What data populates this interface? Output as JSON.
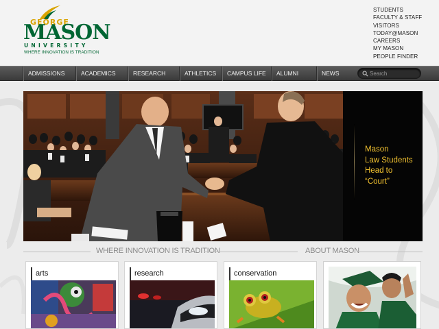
{
  "brand": {
    "george": "GEORGE",
    "mason": "MASON",
    "university": "UNIVERSITY",
    "tagline": "WHERE INNOVATION IS TRADITION",
    "colors": {
      "green": "#006633",
      "gold": "#d9a400"
    }
  },
  "quick_links": [
    "STUDENTS",
    "FACULTY & STAFF",
    "VISITORS",
    "TODAY@MASON",
    "CAREERS",
    "MY MASON",
    "PEOPLE FINDER"
  ],
  "nav": {
    "items": [
      "ADMISSIONS",
      "ACADEMICS",
      "RESEARCH",
      "ATHLETICS",
      "CAMPUS LIFE",
      "ALUMNI",
      "NEWS"
    ],
    "search_placeholder": "Search"
  },
  "hero": {
    "caption_lines": [
      "Mason",
      "Law Students",
      "Head to",
      "“Court”"
    ],
    "caption_color": "#f2c230"
  },
  "sections": {
    "left_title": "WHERE INNOVATION IS TRADITION",
    "right_title": "ABOUT MASON"
  },
  "cards": [
    {
      "label": "arts",
      "icon": "graffiti-art-image"
    },
    {
      "label": "research",
      "icon": "car-headlight-image"
    },
    {
      "label": "conservation",
      "icon": "tree-frog-image"
    }
  ],
  "about": {
    "icon": "graduates-photo"
  }
}
